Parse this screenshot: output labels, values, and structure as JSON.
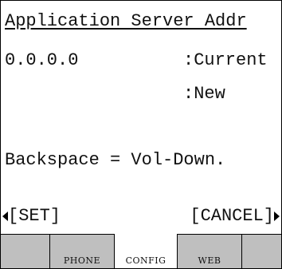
{
  "screen": {
    "title": "Application Server Addr",
    "address_value": "0.0.0.0",
    "label_current": ":Current",
    "label_new": ":New",
    "hint": "Backspace = Vol-Down."
  },
  "softkeys": {
    "left_label": "[SET]",
    "right_label": "[CANCEL]"
  },
  "tabs": {
    "phone": "PHONE",
    "config": "CONFIG",
    "web": "WEB",
    "active": "CONFIG"
  },
  "colors": {
    "tab_inactive": "#bfbfbf",
    "tab_active": "#ffffff",
    "text": "#111111"
  }
}
